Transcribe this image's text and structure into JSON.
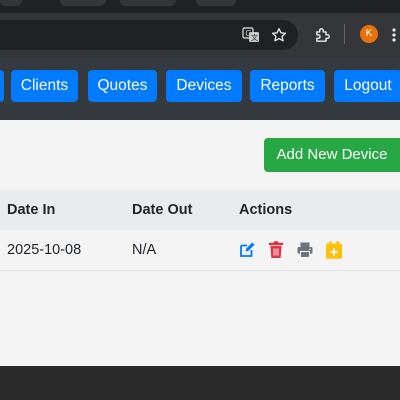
{
  "browser": {
    "profile_initial": "K",
    "icons": [
      "translate-icon",
      "star-icon",
      "extensions-icon",
      "more-icon"
    ],
    "colors": {
      "toolbar": "#35363a",
      "omnibox": "#202124",
      "avatar": "#e8710a"
    }
  },
  "nav": {
    "items": [
      {
        "label": "Clients"
      },
      {
        "label": "Quotes"
      },
      {
        "label": "Devices"
      },
      {
        "label": "Reports"
      },
      {
        "label": "Logout"
      }
    ],
    "colors": {
      "bar": "#343a40",
      "button": "#007bff"
    }
  },
  "main": {
    "add_button_label": "Add New Device",
    "table": {
      "headers": [
        "Date In",
        "Date Out",
        "Actions"
      ],
      "rows": [
        {
          "date_in": "2025-10-08",
          "date_out": "N/A",
          "actions": [
            "edit-icon",
            "delete-icon",
            "print-icon",
            "calendar-add-icon"
          ]
        }
      ]
    },
    "colors": {
      "add_button": "#28a745",
      "edit": "#007bff",
      "delete": "#dc3545",
      "print": "#6c757d",
      "calendar": "#ffc107"
    }
  }
}
